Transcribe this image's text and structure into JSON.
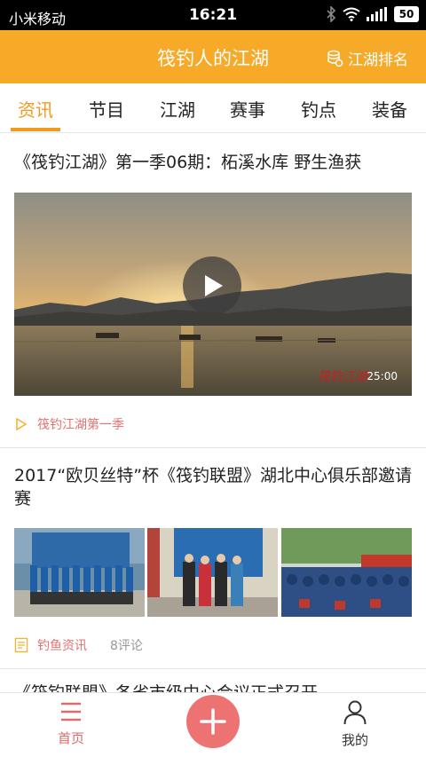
{
  "status_bar": {
    "carrier": "小米移动",
    "time": "16:21",
    "battery": "50"
  },
  "header": {
    "title": "筏钓人的江湖",
    "rank_label": "江湖排名"
  },
  "tabs": [
    {
      "label": "资讯",
      "active": true
    },
    {
      "label": "节目",
      "active": false
    },
    {
      "label": "江湖",
      "active": false
    },
    {
      "label": "赛事",
      "active": false
    },
    {
      "label": "钓点",
      "active": false
    },
    {
      "label": "装备",
      "active": false
    }
  ],
  "feed": {
    "items": [
      {
        "title": "《筏钓江湖》第一季06期：柘溪水库 野生渔获",
        "duration": "25:00",
        "watermark": "筏钓江湖",
        "tag": "筏钓江湖第一季"
      },
      {
        "title": "2017“欧贝丝特”杯《筏钓联盟》湖北中心俱乐部邀请赛",
        "tag": "钓鱼资讯",
        "comments": "8评论"
      },
      {
        "title": "《筏钓联盟》各省市级中心会议正式召开"
      }
    ]
  },
  "bottom_nav": {
    "home_label": "首页",
    "me_label": "我的"
  },
  "colors": {
    "brand": "#f7a928",
    "accent": "#f29a1e",
    "tag": "#e77171",
    "fab": "#ed7373"
  },
  "icons": [
    "bluetooth-icon",
    "wifi-icon",
    "signal-icon",
    "rank-icon",
    "play-icon",
    "video-tag-icon",
    "article-tag-icon",
    "home-icon",
    "plus-icon",
    "user-icon"
  ]
}
